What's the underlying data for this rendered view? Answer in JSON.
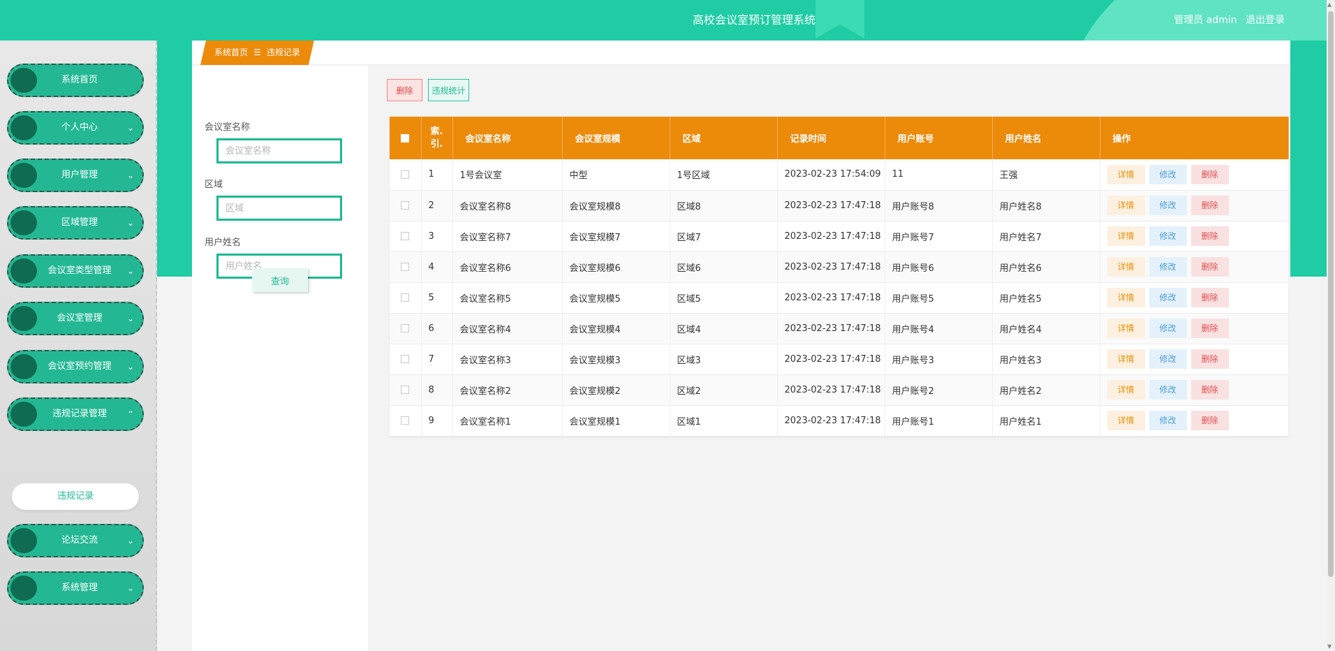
{
  "header": {
    "title": "高校会议室预订管理系统",
    "user_label": "管理员 admin",
    "logout_label": "退出登录"
  },
  "sidebar": {
    "items": [
      {
        "label": "系统首页",
        "chevron": ""
      },
      {
        "label": "个人中心",
        "chevron": "⌄"
      },
      {
        "label": "用户管理",
        "chevron": "⌄"
      },
      {
        "label": "区域管理",
        "chevron": "⌄"
      },
      {
        "label": "会议室类型管理",
        "chevron": "⌄"
      },
      {
        "label": "会议室管理",
        "chevron": "⌄"
      },
      {
        "label": "会议室预约管理",
        "chevron": "⌄"
      },
      {
        "label": "违规记录管理",
        "chevron": "⌃"
      },
      {
        "label": "论坛交流",
        "chevron": "⌄"
      },
      {
        "label": "系统管理",
        "chevron": "⌄"
      }
    ],
    "active_submenu": "违规记录"
  },
  "breadcrumb": {
    "home": "系统首页",
    "separator": "☰",
    "current": "违规记录"
  },
  "search": {
    "fields": [
      {
        "label": "会议室名称",
        "placeholder": "会议室名称"
      },
      {
        "label": "区域",
        "placeholder": "区域"
      },
      {
        "label": "用户姓名",
        "placeholder": "用户姓名"
      }
    ],
    "submit_label": "查询"
  },
  "toolbar": {
    "delete_label": "删除",
    "stats_label": "违规统计"
  },
  "table": {
    "columns": [
      "索引",
      "会议室名称",
      "会议室规模",
      "区域",
      "记录时间",
      "用户账号",
      "用户姓名",
      "操作"
    ],
    "index_header_lines": [
      "索",
      "引"
    ],
    "action_labels": {
      "detail": "详情",
      "edit": "修改",
      "delete": "删除"
    },
    "rows": [
      [
        "1",
        "1号会议室",
        "中型",
        "1号区域",
        "2023-02-23 17:54:09",
        "11",
        "王强"
      ],
      [
        "2",
        "会议室名称8",
        "会议室规模8",
        "区域8",
        "2023-02-23 17:47:18",
        "用户账号8",
        "用户姓名8"
      ],
      [
        "3",
        "会议室名称7",
        "会议室规模7",
        "区域7",
        "2023-02-23 17:47:18",
        "用户账号7",
        "用户姓名7"
      ],
      [
        "4",
        "会议室名称6",
        "会议室规模6",
        "区域6",
        "2023-02-23 17:47:18",
        "用户账号6",
        "用户姓名6"
      ],
      [
        "5",
        "会议室名称5",
        "会议室规模5",
        "区域5",
        "2023-02-23 17:47:18",
        "用户账号5",
        "用户姓名5"
      ],
      [
        "6",
        "会议室名称4",
        "会议室规模4",
        "区域4",
        "2023-02-23 17:47:18",
        "用户账号4",
        "用户姓名4"
      ],
      [
        "7",
        "会议室名称3",
        "会议室规模3",
        "区域3",
        "2023-02-23 17:47:18",
        "用户账号3",
        "用户姓名3"
      ],
      [
        "8",
        "会议室名称2",
        "会议室规模2",
        "区域2",
        "2023-02-23 17:47:18",
        "用户账号2",
        "用户姓名2"
      ],
      [
        "9",
        "会议室名称1",
        "会议室规模1",
        "区域1",
        "2023-02-23 17:47:18",
        "用户账号1",
        "用户姓名1"
      ]
    ]
  },
  "colors": {
    "primary": "#1fcca4",
    "table_header": "#ec8a0a",
    "sidebar_item": "#23b893"
  }
}
